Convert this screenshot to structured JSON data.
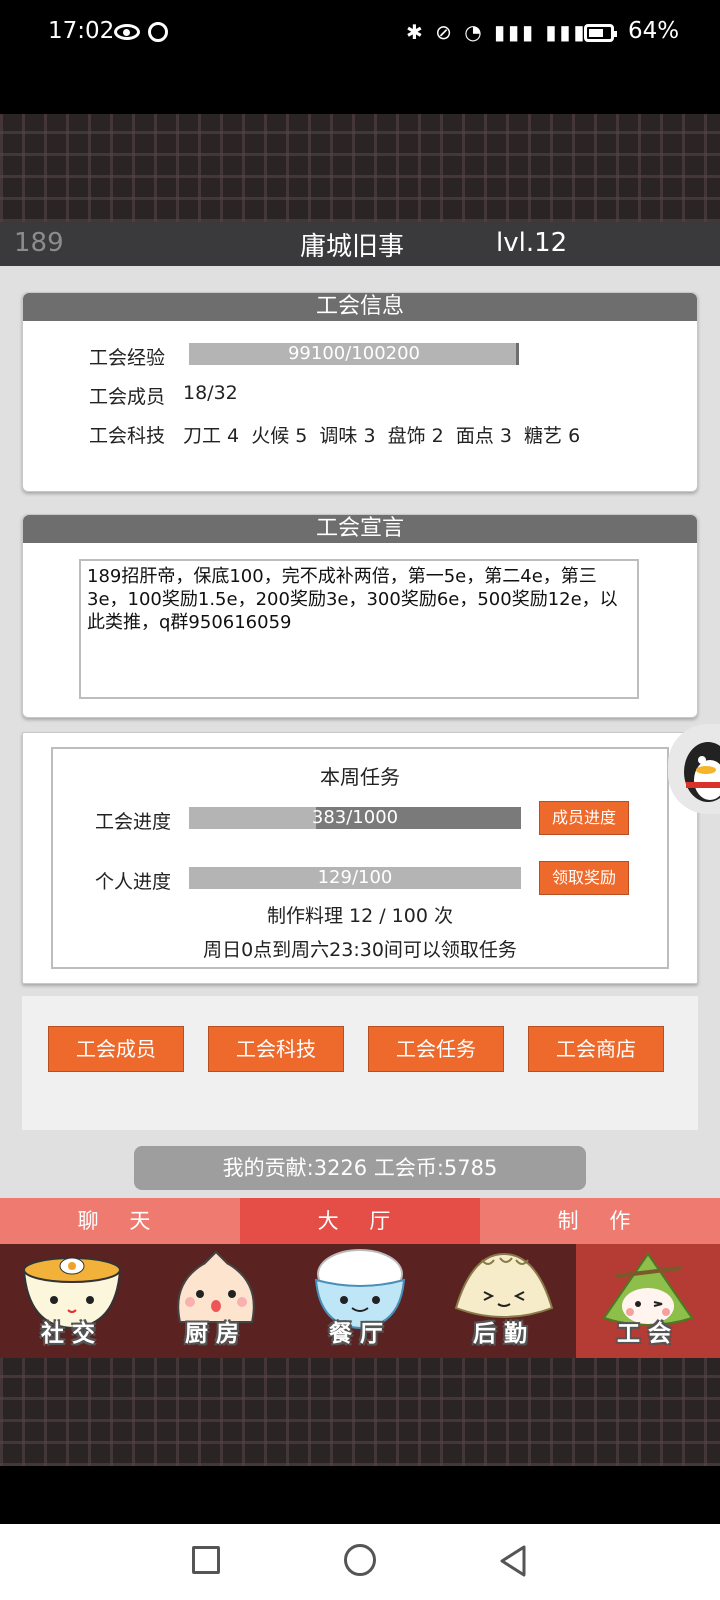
{
  "status_bar": {
    "time": "17:02",
    "battery": "64%",
    "network_icons": "✱ ⊘ ◔ ▮▮▮ ▮▮▮"
  },
  "header": {
    "server_id": "189",
    "guild_name": "庸城旧事",
    "level": "lvl.12"
  },
  "guild_info": {
    "title": "工会信息",
    "exp_label": "工会经验",
    "exp_value": "99100/100200",
    "exp_progress": 0.989,
    "members_label": "工会成员",
    "members_value": "18/32",
    "tech_label": "工会科技",
    "tech_value": "刀工 4  火候 5  调味 3  盘饰 2  面点 3  糖艺 6"
  },
  "declaration": {
    "title": "工会宣言",
    "text": " 189招肝帝，保底100，完不成补两倍，第一5e，第二4e，第三3e，100奖励1.5e，200奖励3e，300奖励6e，500奖励12e，以此类推，q群950616059"
  },
  "weekly_task": {
    "title": "本周任务",
    "guild_progress_label": "工会进度",
    "guild_progress_value": "383/1000",
    "guild_progress": 0.383,
    "member_progress_button": "成员进度",
    "personal_progress_label": "个人进度",
    "personal_progress_value": "129/100",
    "personal_progress": 1.0,
    "claim_button": "领取奖励",
    "cooking_count": "制作料理 12 / 100 次",
    "time_note": "周日0点到周六23:30间可以领取任务"
  },
  "actions": [
    "工会成员",
    "工会科技",
    "工会任务",
    "工会商店"
  ],
  "contribution": "我的贡献:3226  工会币:5785",
  "tabs": [
    "聊 天",
    "大 厅",
    "制 作"
  ],
  "active_tab": 1,
  "nav": [
    {
      "label": "社交",
      "icon": "noodle-bowl-icon"
    },
    {
      "label": "厨房",
      "icon": "steamed-bun-icon"
    },
    {
      "label": "餐厅",
      "icon": "rice-bowl-icon"
    },
    {
      "label": "后勤",
      "icon": "dumpling-icon"
    },
    {
      "label": "工会",
      "icon": "zongzi-icon"
    }
  ],
  "active_nav": 4,
  "colors": {
    "accent": "#ee6a2c",
    "tab_active": "#e54e46",
    "nav_bg": "#5a2220",
    "nav_active": "#b43c34"
  }
}
